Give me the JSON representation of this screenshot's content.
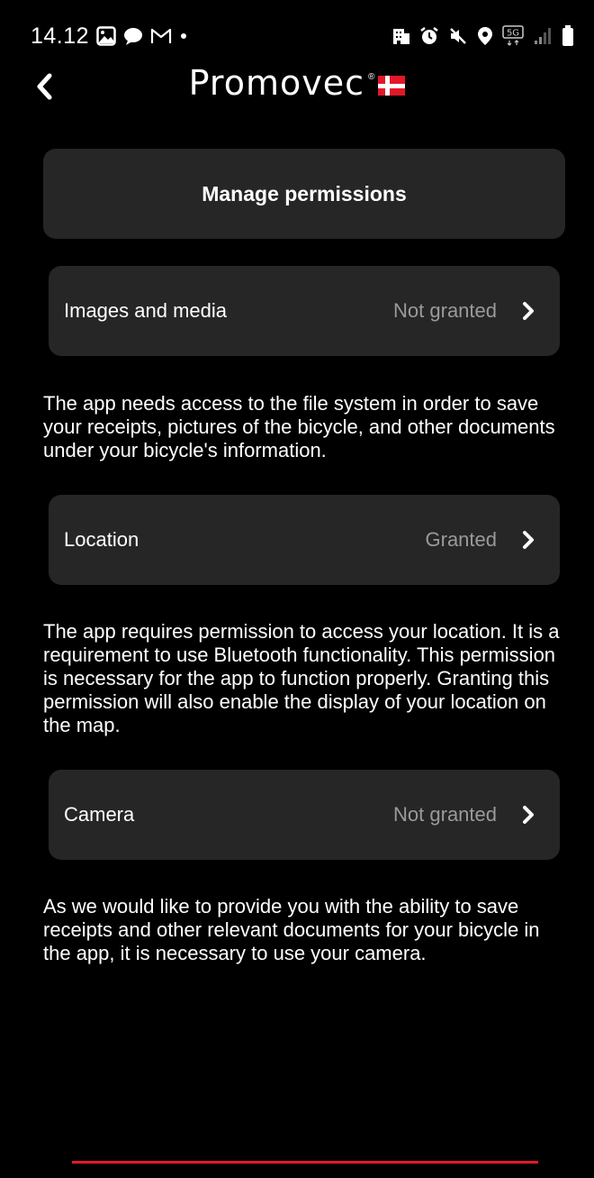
{
  "status_bar": {
    "time": "14.12",
    "network": "5G"
  },
  "header": {
    "brand": "Promovec",
    "brand_mark": "®"
  },
  "page_title": "Manage permissions",
  "permissions": [
    {
      "label": "Images and media",
      "status": "Not granted",
      "description": "The app needs access to the file system in order to save your receipts, pictures of the bicycle, and other documents under your bicycle's information."
    },
    {
      "label": "Location",
      "status": "Granted",
      "description": "The app requires permission to access your location. It is a requirement to use Bluetooth functionality. This permission is necessary for the app to function properly. Granting this permission will also enable the display of your location on the map."
    },
    {
      "label": "Camera",
      "status": "Not granted",
      "description": "As we would like to provide you with the ability to save receipts and other relevant documents for your bicycle in the app, it is necessary to use your camera."
    }
  ],
  "colors": {
    "background": "#000000",
    "card": "#262626",
    "accent": "#e3172a",
    "status_text": "#9a9a9a"
  },
  "icons": [
    "gallery-icon",
    "chat-icon",
    "gmail-icon",
    "dot-icon",
    "building-icon",
    "alarm-icon",
    "mute-icon",
    "location-icon",
    "network-icon",
    "signal-icon",
    "battery-icon",
    "back-chevron-icon",
    "chevron-right-icon",
    "denmark-flag-icon"
  ]
}
